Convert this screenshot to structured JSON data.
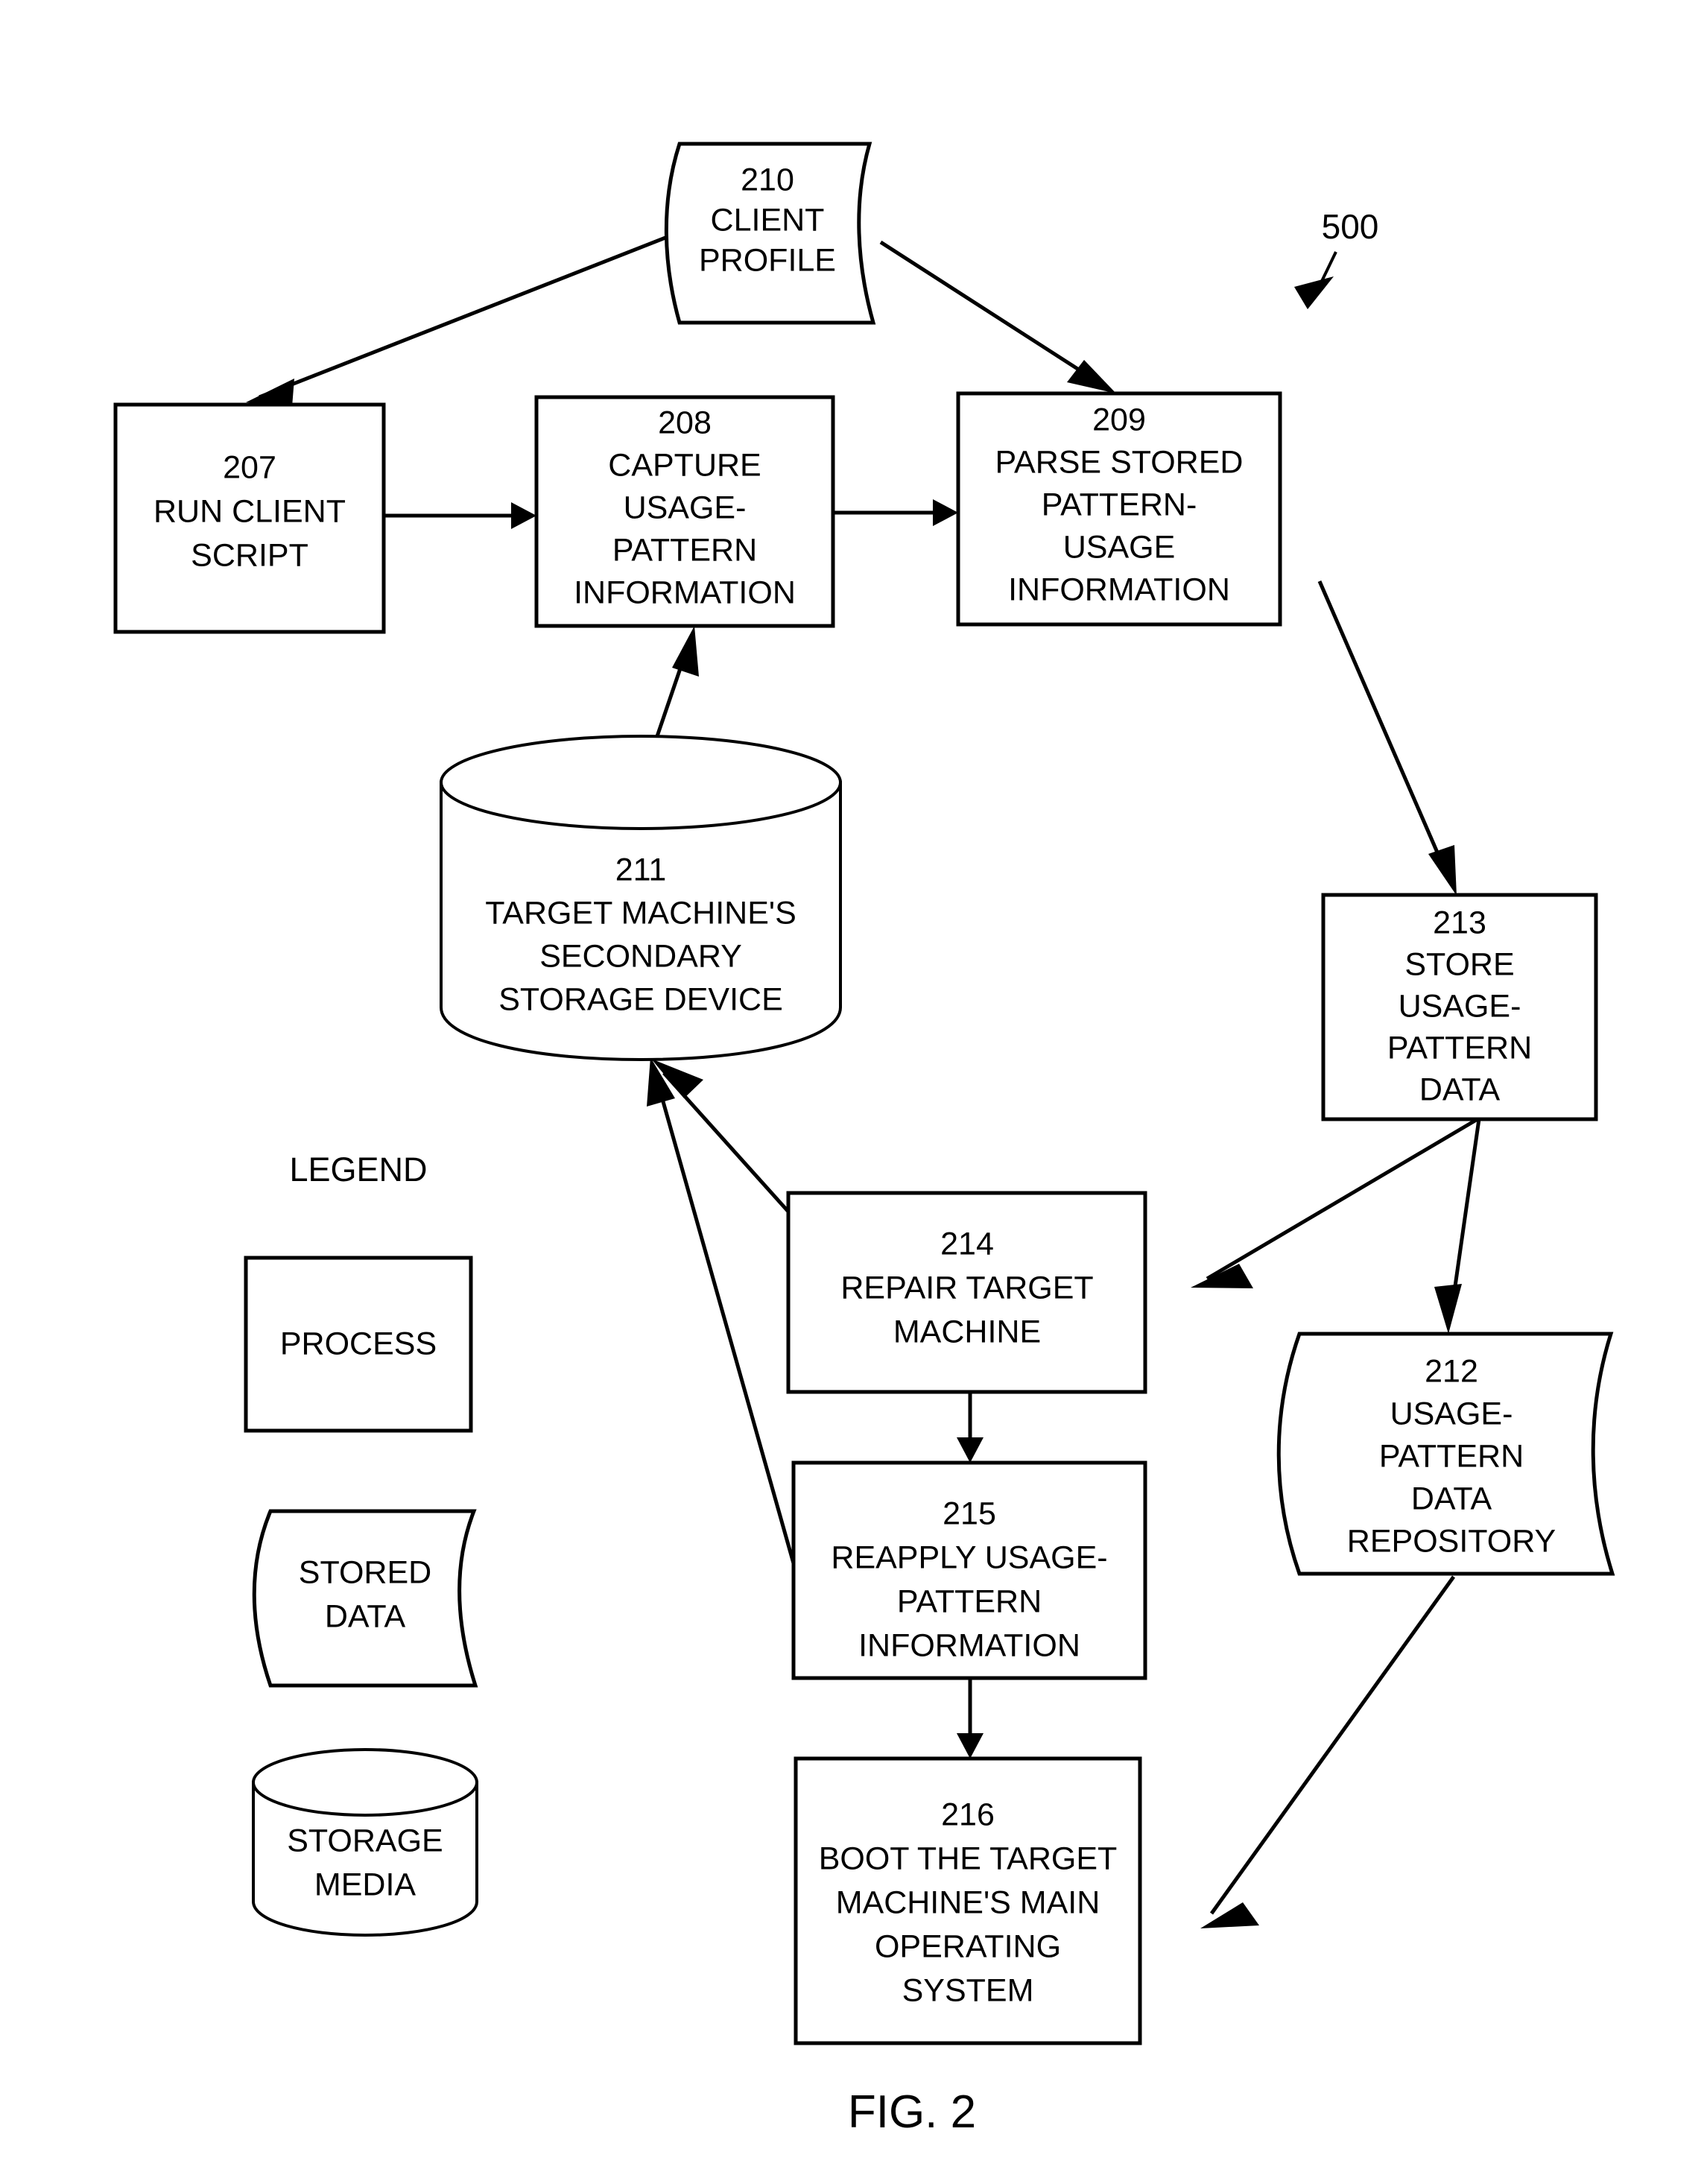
{
  "figure": {
    "caption": "FIG. 2",
    "system_reference": "500"
  },
  "nodes": {
    "n207": {
      "ref": "207",
      "lines": [
        "RUN CLIENT",
        "SCRIPT"
      ],
      "shape": "process"
    },
    "n208": {
      "ref": "208",
      "lines": [
        "CAPTURE",
        "USAGE-",
        "PATTERN",
        "INFORMATION"
      ],
      "shape": "process"
    },
    "n209": {
      "ref": "209",
      "lines": [
        "PARSE STORED",
        "PATTERN-",
        "USAGE",
        "INFORMATION"
      ],
      "shape": "process"
    },
    "n210": {
      "ref": "210",
      "lines": [
        "CLIENT",
        "PROFILE"
      ],
      "shape": "stored-data"
    },
    "n211": {
      "ref": "211",
      "lines": [
        "TARGET MACHINE'S",
        "SECONDARY",
        "STORAGE DEVICE"
      ],
      "shape": "storage-media"
    },
    "n212": {
      "ref": "212",
      "lines": [
        "USAGE-",
        "PATTERN",
        "DATA",
        "REPOSITORY"
      ],
      "shape": "stored-data"
    },
    "n213": {
      "ref": "213",
      "lines": [
        "STORE",
        "USAGE-",
        "PATTERN",
        "DATA"
      ],
      "shape": "process"
    },
    "n214": {
      "ref": "214",
      "lines": [
        "REPAIR TARGET",
        "MACHINE"
      ],
      "shape": "process"
    },
    "n215": {
      "ref": "215",
      "lines": [
        "REAPPLY USAGE-",
        "PATTERN",
        "INFORMATION"
      ],
      "shape": "process"
    },
    "n216": {
      "ref": "216",
      "lines": [
        "BOOT THE TARGET",
        "MACHINE'S MAIN",
        "OPERATING",
        "SYSTEM"
      ],
      "shape": "process"
    }
  },
  "legend": {
    "title": "LEGEND",
    "items": [
      {
        "label": "PROCESS",
        "shape": "process"
      },
      {
        "label_line1": "STORED",
        "label_line2": "DATA",
        "shape": "stored-data"
      },
      {
        "label_line1": "STORAGE",
        "label_line2": "MEDIA",
        "shape": "storage-media"
      }
    ]
  },
  "text": {
    "n207_ref": "207",
    "n207_l1": "RUN CLIENT",
    "n207_l2": "SCRIPT",
    "n208_ref": "208",
    "n208_l1": "CAPTURE",
    "n208_l2": "USAGE-",
    "n208_l3": "PATTERN",
    "n208_l4": "INFORMATION",
    "n209_ref": "209",
    "n209_l1": "PARSE STORED",
    "n209_l2": "PATTERN-",
    "n209_l3": "USAGE",
    "n209_l4": "INFORMATION",
    "n210_ref": "210",
    "n210_l1": "CLIENT",
    "n210_l2": "PROFILE",
    "n211_ref": "211",
    "n211_l1": "TARGET MACHINE'S",
    "n211_l2": "SECONDARY",
    "n211_l3": "STORAGE DEVICE",
    "n212_ref": "212",
    "n212_l1": "USAGE-",
    "n212_l2": "PATTERN",
    "n212_l3": "DATA",
    "n212_l4": "REPOSITORY",
    "n213_ref": "213",
    "n213_l1": "STORE",
    "n213_l2": "USAGE-",
    "n213_l3": "PATTERN",
    "n213_l4": "DATA",
    "n214_ref": "214",
    "n214_l1": "REPAIR TARGET",
    "n214_l2": "MACHINE",
    "n215_ref": "215",
    "n215_l1": "REAPPLY USAGE-",
    "n215_l2": "PATTERN",
    "n215_l3": "INFORMATION",
    "n216_ref": "216",
    "n216_l1": "BOOT THE TARGET",
    "n216_l2": "MACHINE'S MAIN",
    "n216_l3": "OPERATING",
    "n216_l4": "SYSTEM",
    "legend_title": "LEGEND",
    "legend_process": "PROCESS",
    "legend_stored_1": "STORED",
    "legend_stored_2": "DATA",
    "legend_media_1": "STORAGE",
    "legend_media_2": "MEDIA",
    "system_ref": "500",
    "fig_caption": "FIG. 2"
  },
  "flow_edges": [
    {
      "from": "n210",
      "to": "n207",
      "style": "arrow"
    },
    {
      "from": "n210",
      "to": "n209",
      "style": "arrow"
    },
    {
      "from": "n207",
      "to": "n208",
      "style": "arrow"
    },
    {
      "from": "n208",
      "to": "n209",
      "style": "arrow"
    },
    {
      "from": "n209",
      "to": "n213",
      "style": "arrow"
    },
    {
      "from": "n211",
      "to": "n208",
      "style": "arrow"
    },
    {
      "from": "n213",
      "to": "n214",
      "style": "arrow"
    },
    {
      "from": "n213",
      "to": "n212",
      "style": "arrow"
    },
    {
      "from": "n214",
      "to": "n215",
      "style": "arrow"
    },
    {
      "from": "n215",
      "to": "n216",
      "style": "arrow"
    },
    {
      "from": "n214",
      "to": "n211",
      "style": "arrow"
    },
    {
      "from": "n215",
      "to": "n211",
      "style": "arrow"
    },
    {
      "from": "n212",
      "to": "n216",
      "style": "arrow"
    }
  ],
  "colors": {
    "ink": "#000000",
    "paper": "#ffffff"
  }
}
